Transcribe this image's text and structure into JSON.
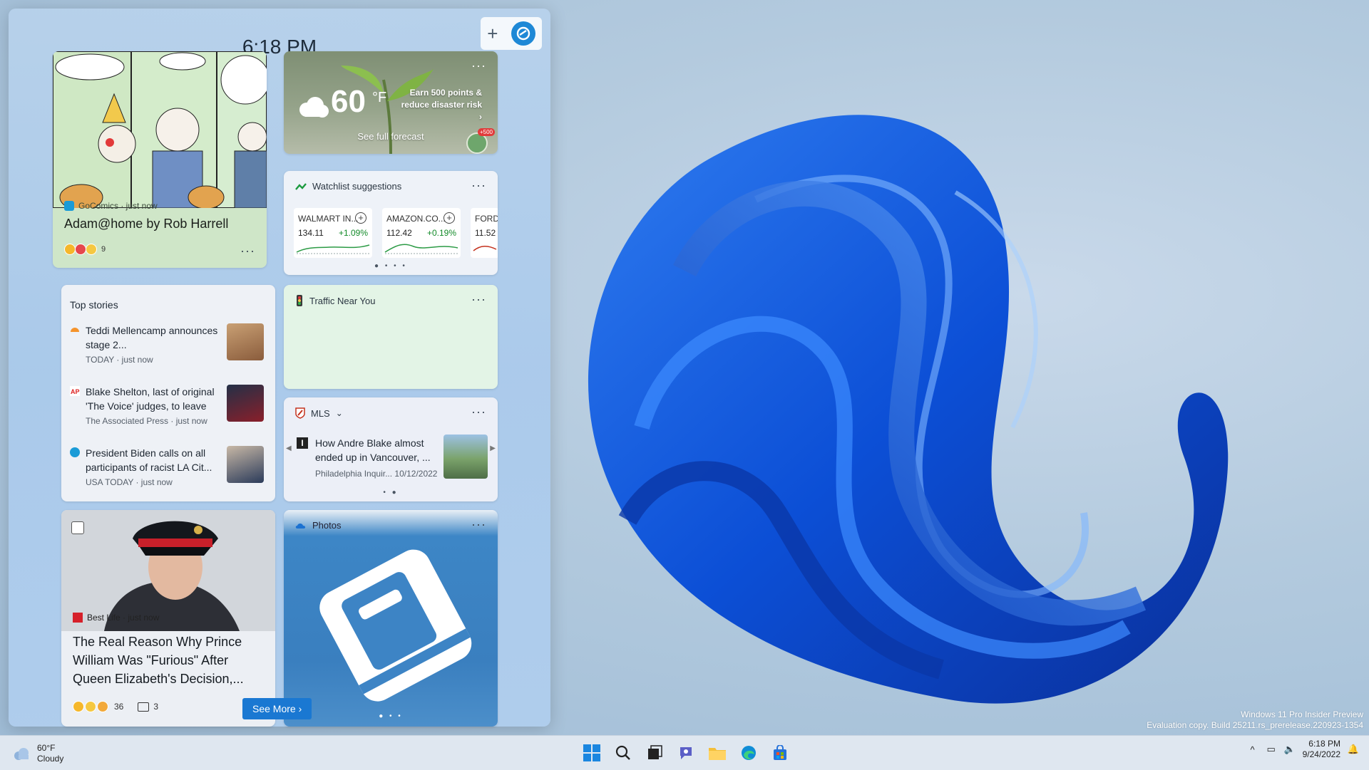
{
  "panel": {
    "time": "6:18 PM"
  },
  "comic": {
    "source": "GoComics · just now",
    "title": "Adam@home by Rob Harrell",
    "reaction_count": "9"
  },
  "weather": {
    "temp": "60",
    "unit": "°F",
    "promo": "Earn 500 points & reduce disaster risk",
    "forecast_link": "See full forecast",
    "badge": "+500"
  },
  "watchlist": {
    "title": "Watchlist suggestions",
    "stocks": [
      {
        "name": "WALMART IN...",
        "price": "134.11",
        "change": "+1.09%"
      },
      {
        "name": "AMAZON.CO...",
        "price": "112.42",
        "change": "+0.19%"
      },
      {
        "name": "FORD",
        "price": "11.52",
        "change": ""
      }
    ]
  },
  "top_stories": {
    "title": "Top stories",
    "items": [
      {
        "headline": "Teddi Mellencamp announces stage 2...",
        "source": "TODAY · just now"
      },
      {
        "headline": "Blake Shelton, last of original 'The Voice' judges, to leave",
        "source": "The Associated Press · just now"
      },
      {
        "headline": "President Biden calls on all participants of racist LA Cit...",
        "source": "USA TODAY · just now"
      }
    ]
  },
  "traffic": {
    "title": "Traffic Near You"
  },
  "mls": {
    "title": "MLS",
    "headline": "How Andre Blake almost ended up in Vancouver, ...",
    "source": "Philadelphia Inquir...  10/12/2022"
  },
  "prince": {
    "source": "Best Life · just now",
    "headline": "The Real Reason Why Prince William Was \"Furious\" After Queen Elizabeth's Decision,...",
    "reaction_count": "36",
    "comment_count": "3",
    "see_more": "See More"
  },
  "photos": {
    "title": "Photos"
  },
  "taskbar": {
    "weather_temp": "60°F",
    "weather_desc": "Cloudy",
    "time": "6:18 PM",
    "date": "9/24/2022"
  },
  "watermark": {
    "line1": "Windows 11 Pro Insider Preview",
    "line2": "Evaluation copy. Build 25211.rs_prerelease.220923-1354"
  }
}
